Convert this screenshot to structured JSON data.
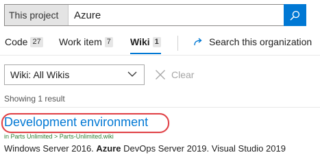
{
  "search": {
    "scope": "This project",
    "query": "Azure"
  },
  "tabs": [
    {
      "label": "Code",
      "count": "27"
    },
    {
      "label": "Work item",
      "count": "7"
    },
    {
      "label": "Wiki",
      "count": "1"
    }
  ],
  "org_link": "Search this organization",
  "filter": {
    "dropdown_value": "Wiki: All Wikis",
    "clear_label": "Clear"
  },
  "results_summary": "Showing 1 result",
  "result": {
    "title": "Development environment",
    "path": "in Parts Unlimited > Parts-Unlimited.wiki",
    "snippet": [
      {
        "text": "Windows Server 2016. ",
        "bold": false
      },
      {
        "text": "Azure",
        "bold": true
      },
      {
        "text": " DevOps Server 2019. Visual Studio 2019",
        "bold": false
      }
    ]
  },
  "colors": {
    "accent": "#0078d4",
    "highlight": "#e04045",
    "path_green": "#2e7d32"
  }
}
